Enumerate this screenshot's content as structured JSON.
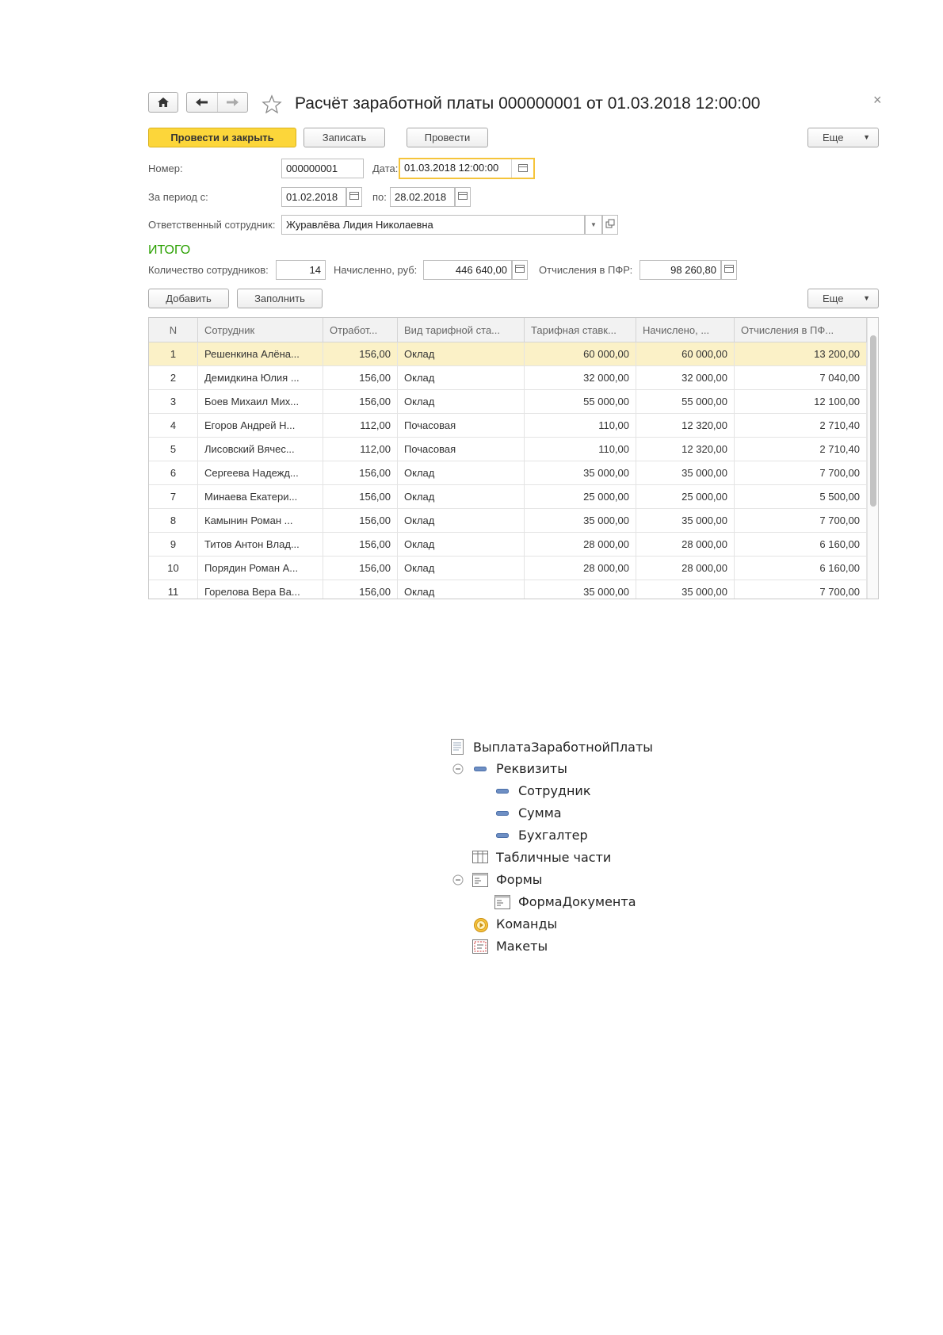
{
  "window": {
    "title": "Расчёт заработной платы 000000001 от 01.03.2018 12:00:00",
    "close_glyph": "×"
  },
  "toolbar": {
    "post_close_label": "Провести и закрыть",
    "save_label": "Записать",
    "post_label": "Провести",
    "more_label": "Еще"
  },
  "form": {
    "number_label": "Номер:",
    "number_value": "000000001",
    "date_label": "Дата:",
    "date_value": "01.03.2018 12:00:00",
    "period_from_label": "За период с:",
    "period_from_value": "01.02.2018",
    "period_to_label": "по:",
    "period_to_value": "28.02.2018",
    "responsible_label": "Ответственный сотрудник:",
    "responsible_value": "Журавлёва Лидия Николаевна"
  },
  "totals": {
    "heading": "ИТОГО",
    "employees_label": "Количество сотрудников:",
    "employees_value": "14",
    "accrued_label": "Начисленно, руб:",
    "accrued_value": "446 640,00",
    "pfr_label": "Отчисления в ПФР:",
    "pfr_value": "98 260,80"
  },
  "table_toolbar": {
    "add_label": "Добавить",
    "fill_label": "Заполнить",
    "more_label": "Еще"
  },
  "table": {
    "columns": [
      "N",
      "Сотрудник",
      "Отработ...",
      "Вид тарифной ста...",
      "Тарифная ставк...",
      "Начислено, ...",
      "Отчисления в ПФ..."
    ],
    "rows": [
      [
        "1",
        "Решенкина Алёна...",
        "156,00",
        "Оклад",
        "60 000,00",
        "60 000,00",
        "13 200,00"
      ],
      [
        "2",
        "Демидкина Юлия ...",
        "156,00",
        "Оклад",
        "32 000,00",
        "32 000,00",
        "7 040,00"
      ],
      [
        "3",
        "Боев Михаил Мих...",
        "156,00",
        "Оклад",
        "55 000,00",
        "55 000,00",
        "12 100,00"
      ],
      [
        "4",
        "Егоров Андрей Н...",
        "112,00",
        "Почасовая",
        "110,00",
        "12 320,00",
        "2 710,40"
      ],
      [
        "5",
        "Лисовский Вячес...",
        "112,00",
        "Почасовая",
        "110,00",
        "12 320,00",
        "2 710,40"
      ],
      [
        "6",
        "Сергеева Надежд...",
        "156,00",
        "Оклад",
        "35 000,00",
        "35 000,00",
        "7 700,00"
      ],
      [
        "7",
        "Минаева Екатери...",
        "156,00",
        "Оклад",
        "25 000,00",
        "25 000,00",
        "5 500,00"
      ],
      [
        "8",
        "Камынин Роман ...",
        "156,00",
        "Оклад",
        "35 000,00",
        "35 000,00",
        "7 700,00"
      ],
      [
        "9",
        "Титов Антон Влад...",
        "156,00",
        "Оклад",
        "28 000,00",
        "28 000,00",
        "6 160,00"
      ],
      [
        "10",
        "Порядин Роман А...",
        "156,00",
        "Оклад",
        "28 000,00",
        "28 000,00",
        "6 160,00"
      ],
      [
        "11",
        "Горелова Вера Ва...",
        "156,00",
        "Оклад",
        "35 000,00",
        "35 000,00",
        "7 700,00"
      ]
    ]
  },
  "tree": {
    "root": "ВыплатаЗаработнойПлаты",
    "attributes": "Реквизиты",
    "attr_items": [
      "Сотрудник",
      "Сумма",
      "Бухгалтер"
    ],
    "tabular_parts": "Табличные части",
    "forms": "Формы",
    "form_items": [
      "ФормаДокумента"
    ],
    "commands": "Команды",
    "templates": "Макеты"
  },
  "colors": {
    "primary_button": "#fcd63a",
    "totals_heading": "#2aa000",
    "selected_row": "#fbf1c7",
    "focus_border": "#f5c43b"
  }
}
